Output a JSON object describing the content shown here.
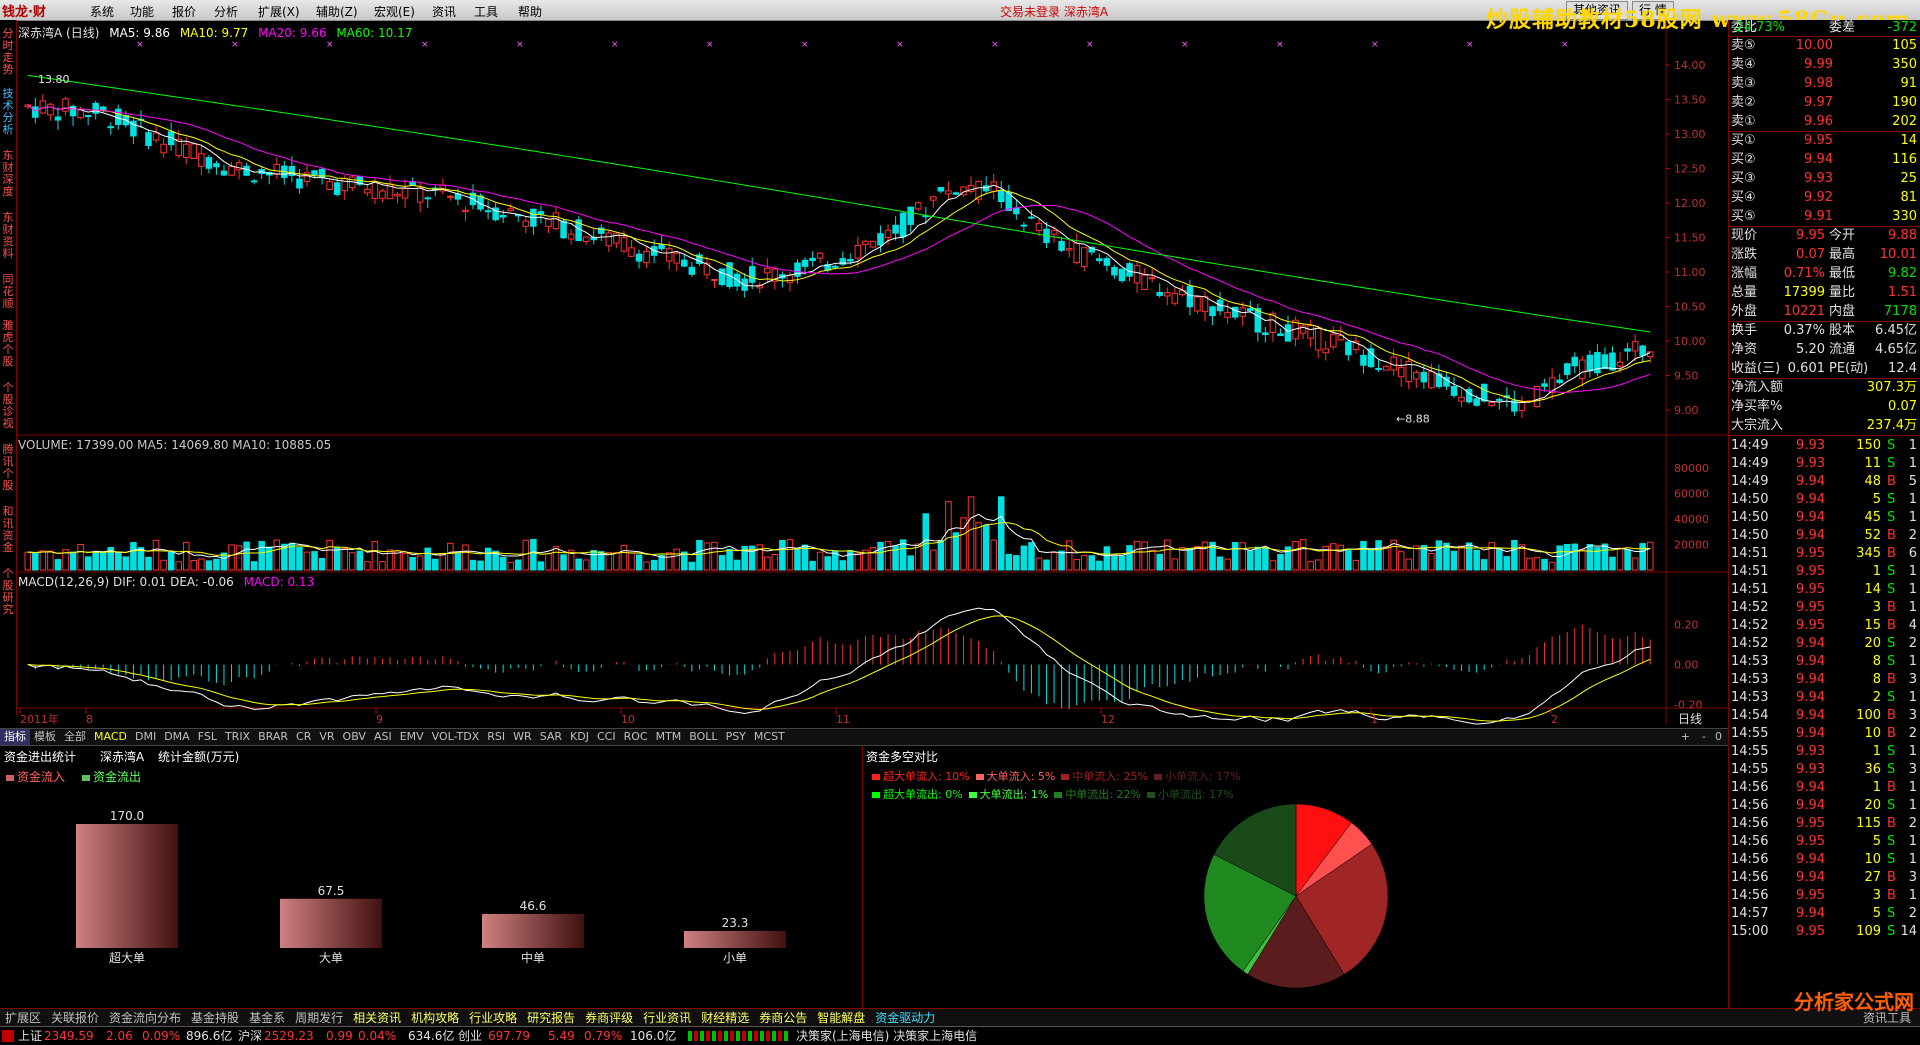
{
  "menubar": {
    "logo": "钱龙·财",
    "items": [
      "系统",
      "功能",
      "报价",
      "分析",
      "扩展(X)",
      "辅助(Z)",
      "宏观(E)",
      "资讯",
      "工具",
      "帮助"
    ],
    "center_text": "交易未登录  深赤湾A",
    "right_buttons": [
      "其他资讯",
      "行 情"
    ],
    "watermark": "炒股辅助教材58股网 www.58Gu.com"
  },
  "left_tabs": [
    "分时走势",
    "技术分析",
    "东财深度",
    "东财资料",
    "同花顺",
    "雅虎个股",
    "个股诊视",
    "腾讯个股",
    "和讯资金",
    "个股研究"
  ],
  "chart": {
    "title": "深赤湾A (日线)",
    "ma_legend": [
      {
        "label": "MA5: 9.86",
        "color": "#ffffff"
      },
      {
        "label": "MA10: 9.77",
        "color": "#ffff00"
      },
      {
        "label": "MA20: 9.66",
        "color": "#ff00ff"
      },
      {
        "label": "MA60: 10.17",
        "color": "#00ff00"
      }
    ],
    "high_label": "13.80",
    "low_label": "8.88",
    "price_axis": [
      "14.00",
      "13.50",
      "13.00",
      "12.50",
      "12.00",
      "11.50",
      "11.00",
      "10.50",
      "10.00",
      "9.50",
      "9.00"
    ],
    "volume_legend": "VOLUME: 17399.00  MA5: 14069.80  MA10: 10885.05",
    "volume_axis": [
      "80000",
      "60000",
      "40000",
      "20000"
    ],
    "macd_legend_a": "MACD(12,26,9)  DIF: 0.01  DEA: -0.06",
    "macd_legend_b": "MACD: 0.13",
    "macd_axis": [
      "0.20",
      "0.00",
      "-0.20"
    ],
    "date_axis": [
      "2011年",
      "8",
      "9",
      "10",
      "11",
      "12",
      "1",
      "2"
    ],
    "period_label": "日线"
  },
  "indicator_tabs": [
    "指标",
    "模板",
    "全部",
    "MACD",
    "DMI",
    "DMA",
    "FSL",
    "TRIX",
    "BRAR",
    "CR",
    "VR",
    "OBV",
    "ASI",
    "EMV",
    "VOL-TDX",
    "RSI",
    "WR",
    "SAR",
    "KDJ",
    "CCI",
    "ROC",
    "MTM",
    "BOLL",
    "PSY",
    "MCST"
  ],
  "indicator_controls": [
    "+",
    "-",
    "0"
  ],
  "fund_panel": {
    "title": "资金进出统计",
    "stock": "深赤湾A",
    "unit": "统计金额(万元)",
    "legend_in": "资金流入",
    "legend_out": "资金流出",
    "bars": [
      {
        "label": "超大单",
        "value": 170.0
      },
      {
        "label": "大单",
        "value": 67.5
      },
      {
        "label": "中单",
        "value": 46.6
      },
      {
        "label": "小单",
        "value": 23.3
      }
    ]
  },
  "pie_panel": {
    "title": "资金多空对比",
    "legend_row1": [
      {
        "label": "超大单流入: 10%",
        "color": "#ff2020"
      },
      {
        "label": "大单流入: 5%",
        "color": "#ff6060"
      },
      {
        "label": "中单流入: 25%",
        "color": "#a02020"
      },
      {
        "label": "小单流入: 17%",
        "color": "#602020"
      }
    ],
    "legend_row2": [
      {
        "label": "超大单流出: 0%",
        "color": "#00ff00"
      },
      {
        "label": "大单流出: 1%",
        "color": "#40ff40"
      },
      {
        "label": "中单流出: 22%",
        "color": "#208020"
      },
      {
        "label": "小单流出: 17%",
        "color": "#205020"
      }
    ],
    "slices": [
      {
        "value": 10,
        "color": "#ff1010"
      },
      {
        "value": 5,
        "color": "#ff5050"
      },
      {
        "value": 25,
        "color": "#a02525"
      },
      {
        "value": 17,
        "color": "#5a1c1c"
      },
      {
        "value": 0,
        "color": "#00ff00"
      },
      {
        "value": 1,
        "color": "#40c040"
      },
      {
        "value": 22,
        "color": "#208a20"
      },
      {
        "value": 17,
        "color": "#1a4a1a"
      }
    ]
  },
  "quote": {
    "top_partial": {
      "left": "委比",
      "val": "-24.73%",
      "left2": "委差",
      "val2": "-372"
    },
    "sells": [
      {
        "label": "卖⑤",
        "price": "10.00",
        "vol": "105"
      },
      {
        "label": "卖④",
        "price": "9.99",
        "vol": "350"
      },
      {
        "label": "卖③",
        "price": "9.98",
        "vol": "91"
      },
      {
        "label": "卖②",
        "price": "9.97",
        "vol": "190"
      },
      {
        "label": "卖①",
        "price": "9.96",
        "vol": "202"
      }
    ],
    "buys": [
      {
        "label": "买①",
        "price": "9.95",
        "vol": "14"
      },
      {
        "label": "买②",
        "price": "9.94",
        "vol": "116"
      },
      {
        "label": "买③",
        "price": "9.93",
        "vol": "25"
      },
      {
        "label": "买④",
        "price": "9.92",
        "vol": "81"
      },
      {
        "label": "买⑤",
        "price": "9.91",
        "vol": "330"
      }
    ],
    "stats": [
      {
        "l1": "现价",
        "v1": "9.95",
        "c1": "red",
        "l2": "今开",
        "v2": "9.88",
        "c2": "red"
      },
      {
        "l1": "涨跌",
        "v1": "0.07",
        "c1": "red",
        "l2": "最高",
        "v2": "10.01",
        "c2": "red"
      },
      {
        "l1": "涨幅",
        "v1": "0.71%",
        "c1": "red",
        "l2": "最低",
        "v2": "9.82",
        "c2": "grn"
      },
      {
        "l1": "总量",
        "v1": "17399",
        "c1": "yel",
        "l2": "量比",
        "v2": "1.51",
        "c2": "red"
      },
      {
        "l1": "外盘",
        "v1": "10221",
        "c1": "red",
        "l2": "内盘",
        "v2": "7178",
        "c2": "grn"
      }
    ],
    "stats2": [
      {
        "l1": "换手",
        "v1": "0.37%",
        "l2": "股本",
        "v2": "6.45亿"
      },
      {
        "l1": "净资",
        "v1": "5.20",
        "l2": "流通",
        "v2": "4.65亿"
      },
      {
        "l1": "收益(三)",
        "v1": "0.601",
        "l2": "PE(动)",
        "v2": "12.4"
      }
    ],
    "flows": [
      {
        "label": "净流入额",
        "val": "307.3万"
      },
      {
        "label": "净买率%",
        "val": "0.07"
      },
      {
        "label": "大宗流入",
        "val": "237.4万"
      }
    ],
    "ticks": [
      [
        "14:49",
        "9.93",
        "150",
        "S",
        "1"
      ],
      [
        "14:49",
        "9.93",
        "11",
        "S",
        "1"
      ],
      [
        "14:49",
        "9.94",
        "48",
        "B",
        "5"
      ],
      [
        "14:50",
        "9.94",
        "5",
        "S",
        "1"
      ],
      [
        "14:50",
        "9.94",
        "45",
        "S",
        "1"
      ],
      [
        "14:50",
        "9.94",
        "52",
        "B",
        "2"
      ],
      [
        "14:51",
        "9.95",
        "345",
        "B",
        "6"
      ],
      [
        "14:51",
        "9.95",
        "1",
        "S",
        "1"
      ],
      [
        "14:51",
        "9.95",
        "14",
        "S",
        "1"
      ],
      [
        "14:52",
        "9.95",
        "3",
        "B",
        "1"
      ],
      [
        "14:52",
        "9.95",
        "15",
        "B",
        "4"
      ],
      [
        "14:52",
        "9.94",
        "20",
        "S",
        "2"
      ],
      [
        "14:53",
        "9.94",
        "8",
        "S",
        "1"
      ],
      [
        "14:53",
        "9.94",
        "8",
        "B",
        "3"
      ],
      [
        "14:53",
        "9.94",
        "2",
        "S",
        "1"
      ],
      [
        "14:54",
        "9.94",
        "100",
        "B",
        "3"
      ],
      [
        "14:55",
        "9.94",
        "10",
        "B",
        "2"
      ],
      [
        "14:55",
        "9.93",
        "1",
        "S",
        "1"
      ],
      [
        "14:55",
        "9.93",
        "36",
        "S",
        "3"
      ],
      [
        "14:56",
        "9.94",
        "1",
        "B",
        "1"
      ],
      [
        "14:56",
        "9.94",
        "20",
        "S",
        "1"
      ],
      [
        "14:56",
        "9.95",
        "115",
        "B",
        "2"
      ],
      [
        "14:56",
        "9.95",
        "5",
        "S",
        "1"
      ],
      [
        "14:56",
        "9.94",
        "10",
        "S",
        "1"
      ],
      [
        "14:56",
        "9.94",
        "27",
        "B",
        "3"
      ],
      [
        "14:56",
        "9.95",
        "3",
        "B",
        "1"
      ],
      [
        "14:57",
        "9.94",
        "5",
        "S",
        "2"
      ],
      [
        "15:00",
        "9.95",
        "109",
        "S",
        "14"
      ]
    ]
  },
  "bottom_tabs": [
    "扩展区",
    "关联报价",
    "资金流向分布",
    "基金持股",
    "基金系",
    "周期发行",
    "相关资讯",
    "机构攻略",
    "行业攻略",
    "研究报告",
    "券商评级",
    "行业资讯",
    "财经精选",
    "券商公告",
    "智能解盘",
    "资金驱动力"
  ],
  "bottom_right": "资讯工具",
  "status": {
    "sh_label": "上证",
    "sh_index": "2349.59",
    "sh_chg": "2.06",
    "sh_pct": "0.09%",
    "sh_amt": "896.6亿",
    "hs_label": "沪深",
    "hs_index": "2529.23",
    "hs_chg": "0.99",
    "hs_pct": "0.04%",
    "hs_amt": "634.6亿",
    "cy_label": "创业",
    "cy_index": "697.79",
    "cy_chg": "5.49",
    "cy_pct": "0.79%",
    "cy_amt": "106.0亿",
    "conn": "决策家(上海电信)  决策家上海电信"
  },
  "corner_logo": "分析家公式网"
}
